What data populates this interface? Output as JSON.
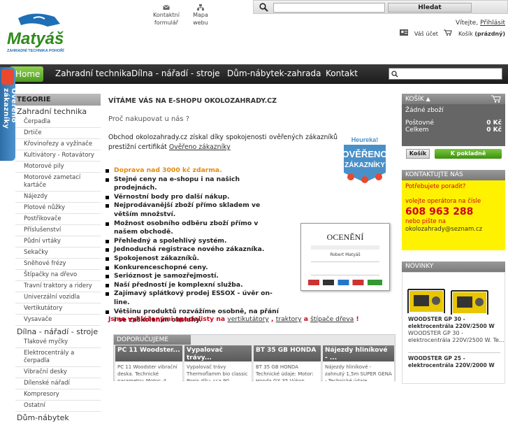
{
  "header": {
    "logo_text": "Matyáš",
    "logo_subtitle": "ZAHRADNÍ TECHNIKA  POHOŘÍ",
    "contact_link": "Kontaktní formulář",
    "map_link": "Mapa webu",
    "search_placeholder": "",
    "search_button": "Hledat",
    "welcome": "Vítejte,",
    "login": "Přihlásit",
    "account": "Váš účet",
    "cart_link": "Košík",
    "cart_state": "(prázdný)"
  },
  "nav": {
    "home": "Home",
    "items": [
      "Zahradní technika",
      "Dílna - nářadí - stroje",
      "Dům-nábytek-zahrada",
      "Kontakt"
    ]
  },
  "verified_tab": "Ověřeno zákazníky",
  "sidebar": {
    "header": "TEGORIE",
    "cat1": "Zahradní technika",
    "cat1_items": [
      "Čerpadla",
      "Drtiče",
      "Křovinořezy a vyžínače",
      "Kultivátory - Rotavátory",
      "Motorové pily",
      "Motorové zametací kartáče",
      "Nájezdy",
      "Plotové nůžky",
      "Postřikovače",
      "Příslušenství",
      "Půdní vrtáky",
      "Sekačky",
      "Sněhové frézy",
      "Štípačky na dřevo",
      "Travní traktory a ridery",
      "Univerzální vozidla",
      "Vertikutátory",
      "Vysavače"
    ],
    "cat2": "Dílna - nářadí - stroje",
    "cat2_items": [
      "Tlakové myčky",
      "Elektrocentrály a čerpadla",
      "Vibrační desky",
      "Dílenské nářadí",
      "Kompresory",
      "Ostatní"
    ],
    "cat3": "Dům-nábytek"
  },
  "main": {
    "title": "VÍTÁME VÁS NA E-SHOPU OKOLOZAHRADY.CZ",
    "why": "Proč nakupovat u nás ?",
    "intro": "Obchod okolozahrady.cz získal díky spokojenosti ověřených zákazníků prestižní certifikát",
    "intro_link": "Ověřeno zákazníky",
    "heureka_top": "Heureka!",
    "heureka_main": "OVĚŘENO",
    "heureka_sub": "ZÁKAZNÍKY",
    "benefits": [
      "Doprava nad 3000 kč zdarma.",
      "Stejné ceny na e-shopu i na našich prodejnách.",
      "Věrnostní body pro další nákup.",
      "Nejprodávanější zboží přímo skladem ve větším množství.",
      "Možnost osobního odběru zboží přímo v našem obchodě.",
      "Přehledný a spolehlivý systém.",
      "Jednoduchá registrace nového zákazníka.",
      "Spokojenost zákazníků.",
      "Konkurenceschopné ceny.",
      "Serióznost je samozřejmostí.",
      "Naší předností je komplexní služba.",
      "Zajímavý splátkový prodej ESSOX - úvěr on-line.",
      "Většinu produktů rozvážíme osobně, na přání i se zaškolením obsluhy."
    ],
    "award_title": "OCENĚNÍ",
    "award_name": "Robert Matyáš",
    "specialists_prefix": "Jsme vyhlášenými specialisty na",
    "spec_links": [
      "vertikutátory",
      "traktory",
      "štípače dřeva"
    ],
    "spec_sep1": ",",
    "spec_and": "a",
    "spec_end": "!"
  },
  "recommended": {
    "header": "DOPORUČUJEME",
    "products": [
      {
        "title": "PC 11 Woodster...",
        "desc": "PC 11 Woodster vibrační deska. Technické parametry: Motor: 4"
      },
      {
        "title": "Vypalovač trávy...",
        "desc": "Vypalovač trávy Thermoflamm bio classic Popis dílu: cca 90"
      },
      {
        "title": "BT 35 GB HONDA",
        "desc": "BT 35 GB HONDA Technické údaje: Motor: Honda GX 35 Výkon"
      },
      {
        "title": "Nájezdy hliníkové - ...",
        "desc": "Nájezdy hliníkové - zahnutý 1,5m SUPER GENA - Technické údaje"
      }
    ]
  },
  "cart": {
    "header": "KOŠÍK",
    "empty": "Žádné zboží",
    "shipping_label": "Poštovné",
    "shipping_value": "0 Kč",
    "total_label": "Celkem",
    "total_value": "0 Kč",
    "cart_button": "Košík",
    "checkout_button": "K pokladně"
  },
  "contact": {
    "header": "KONTAKTUJTE NÁS",
    "help": "Potřebujete poradit?",
    "call": "volejte operátora na čísle",
    "phone": "608 963 288",
    "write": "nebo pište na",
    "email": "okolozahrady@seznam.cz"
  },
  "news": {
    "header": "NOVINKY",
    "items": [
      {
        "title": "WOODSTER GP 30 - elektrocentrála 220V/2500 W",
        "desc": "WOODSTER GP 30 - elektrocentrála 220V/2500 W. Te..."
      },
      {
        "title": "WOODSTER GP 25 - elektrocentrála 220V/2000 W",
        "desc": ""
      }
    ]
  },
  "colors": {
    "nav_bg": "#1b1b1b",
    "home_green": "#4e9a22",
    "accent_red": "#d0021b",
    "highlight_orange": "#e08a10",
    "contact_yellow": "#fff200"
  }
}
